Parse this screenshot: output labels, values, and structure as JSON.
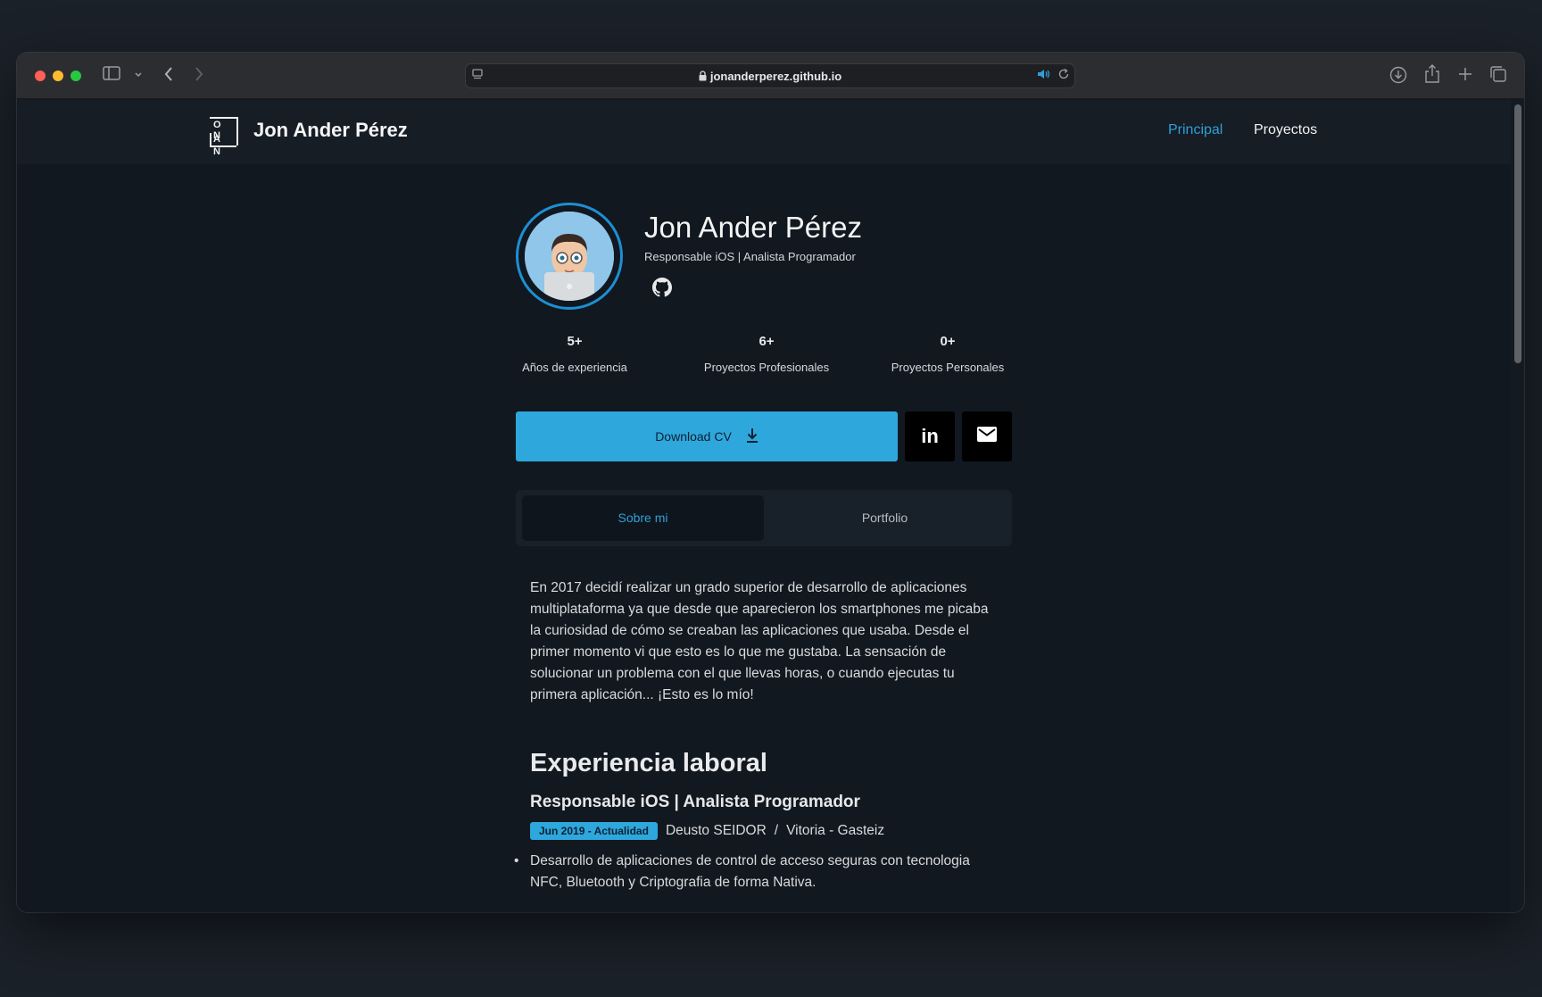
{
  "browser": {
    "url": "jonanderperez.github.io"
  },
  "nav": {
    "logo_row1": "O N",
    "logo_row2": "A N",
    "brand": "Jon Ander Pérez",
    "links": [
      {
        "label": "Principal",
        "active": true
      },
      {
        "label": "Proyectos",
        "active": false
      }
    ]
  },
  "profile": {
    "name": "Jon Ander Pérez",
    "title": "Responsable iOS | Analista Programador"
  },
  "stats": [
    {
      "value": "5+",
      "label": "Años de experiencia"
    },
    {
      "value": "6+",
      "label": "Proyectos Profesionales"
    },
    {
      "value": "0+",
      "label": "Proyectos Personales"
    }
  ],
  "actions": {
    "download_label": "Download CV",
    "download_icon": "download-icon",
    "linkedin_label": "in",
    "mail_icon": "mail-icon"
  },
  "tabs": [
    {
      "label": "Sobre mi",
      "active": true
    },
    {
      "label": "Portfolio",
      "active": false
    }
  ],
  "about": {
    "text": "En 2017 decidí realizar un grado superior de desarrollo de aplicaciones multiplataforma ya que desde que aparecieron los smartphones me picaba la curiosidad de cómo se creaban las aplicaciones que usaba. Desde el primer momento vi que esto es lo que me gustaba. La sensación de solucionar un problema con el que llevas horas, o cuando ejecutas tu primera aplicación... ¡Esto es lo mío!"
  },
  "experience": {
    "section_title": "Experiencia laboral",
    "jobs": [
      {
        "title": "Responsable iOS | Analista Programador",
        "period": "Jun 2019 - Actualidad",
        "company": "Deusto SEIDOR",
        "separator": "/",
        "location": "Vitoria - Gasteiz",
        "bullets": [
          "Desarrollo de aplicaciones de control de acceso seguras con tecnologia NFC, Bluetooth y Criptografia de forma Nativa."
        ]
      }
    ]
  },
  "colors": {
    "accent": "#2ea7dc",
    "background": "#111820",
    "navbar": "#161d25"
  }
}
